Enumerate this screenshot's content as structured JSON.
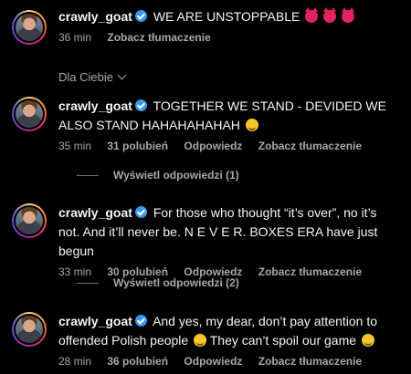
{
  "comments": [
    {
      "username": "crawly_goat",
      "text": "WE ARE UNSTOPPABLE",
      "emojis": [
        "devil",
        "devil",
        "devil"
      ],
      "time": "36 min",
      "likes": "",
      "reply_label": "",
      "translate_label": "Zobacz tłumaczenie"
    },
    {
      "username": "crawly_goat",
      "text": "TOGETHER WE STAND - DEVIDED WE ALSO STAND HAHAHAHAHAH",
      "emojis": [
        "smirk"
      ],
      "time": "35 min",
      "likes": "31 polubień",
      "reply_label": "Odpowiedz",
      "translate_label": "Zobacz tłumaczenie",
      "view_replies": "Wyświetl odpowiedzi (1)"
    },
    {
      "username": "crawly_goat",
      "text": "For those who thought “it’s over”, no it’s not. And it’ll never be. N E V E R. BOXES ERA have just begun",
      "time": "33 min",
      "likes": "30 polubień",
      "reply_label": "Odpowiedz",
      "translate_label": "Zobacz tłumaczenie",
      "view_replies": "Wyświetl odpowiedzi (2)"
    },
    {
      "username": "crawly_goat",
      "text_part1": "And yes, my dear, don’t pay attention to offended Polish people",
      "text_part2": "They can’t spoil our game",
      "emojis": [
        "smile",
        "tongue"
      ],
      "time": "28 min",
      "likes": "36 polubień",
      "reply_label": "Odpowiedz",
      "translate_label": "Zobacz tłumaczenie"
    }
  ],
  "section": {
    "label": "Dla Ciebie"
  },
  "colors": {
    "background": "#000000",
    "text": "#f5f5f5",
    "muted": "#a8a8a8",
    "verified": "#3897f0"
  }
}
